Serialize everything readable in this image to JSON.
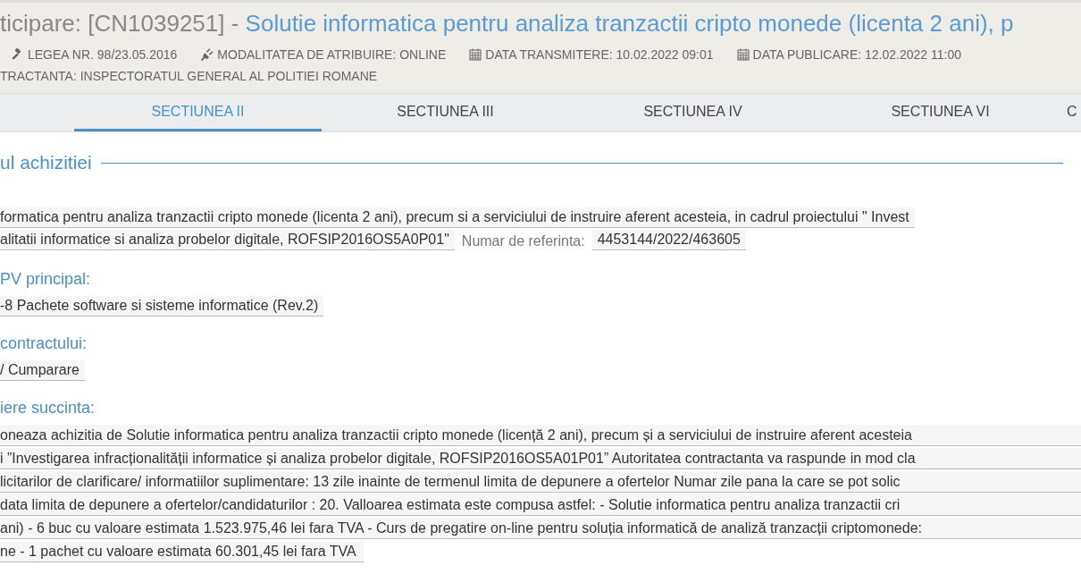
{
  "header": {
    "title_prefix": "ticipare: [CN1039251] - ",
    "title": "Solutie informatica pentru analiza tranzactii cripto monede (licenta 2 ani), p",
    "meta": [
      {
        "kind": "gavel",
        "text": "LEGEA NR. 98/23.05.2016"
      },
      {
        "kind": "plug",
        "text": "MODALITATEA DE ATRIBUIRE: ONLINE"
      },
      {
        "kind": "calendar",
        "text": "DATA TRANSMITERE: 10.02.2022 09:01"
      },
      {
        "kind": "calendar",
        "text": "DATA PUBLICARE: 12.02.2022 11:00"
      }
    ],
    "authority": "TRACTANTA: INSPECTORATUL GENERAL AL POLITIEI ROMANE"
  },
  "tabs": [
    {
      "label": "SECTIUNEA II",
      "selected": true
    },
    {
      "label": "SECTIUNEA III",
      "selected": false
    },
    {
      "label": "SECTIUNEA IV",
      "selected": false
    },
    {
      "label": "SECTIUNEA VI",
      "selected": false
    },
    {
      "label": "C",
      "selected": false
    }
  ],
  "section": {
    "legend": "ul achizitiei",
    "title_lines": [
      "formatica pentru analiza tranzactii cripto monede (licenta 2 ani), precum si a serviciului de instruire aferent acesteia, in cadrul proiectului \" Invest",
      "alitatii informatice si analiza probelor digitale, ROFSIP2016OS5A0P01\""
    ],
    "reference_label": "Numar de referinta:",
    "reference_value": "4453144/2022/463605",
    "cpv_label": "PV principal:",
    "cpv_value": "-8 Pachete software si sisteme informatice (Rev.2)",
    "type_label": "contractului:",
    "type_value": "/ Cumparare",
    "description_label": "iere succinta:",
    "description_lines": [
      "oneaza achizitia de Solutie informatica pentru analiza tranzactii cripto monede (licență 2 ani), precum și a serviciului de instruire aferent acesteia",
      "i ”Investigarea infracționalității informatice și analiza probelor digitale, ROFSIP2016OS5A01P01” Autoritatea contractanta va raspunde in mod cla",
      "licitarilor de clarificare/ informatiilor suplimentare: 13 zile inainte de termenul limita de depunere a ofertelor Numar zile pana la care se pot solic",
      "data limita de depunere a ofertelor/candidaturilor : 20. Valloarea estimata este compusa astfel: - Solutie informatica pentru analiza tranzactii cri",
      "ani) - 6 buc cu valoare estimata 1.523.975,46 lei fara TVA - Curs de pregatire on-line pentru soluția informatică de analiză tranzacții criptomonede:",
      "ne - 1 pachet cu valoare estimata 60.301,45 lei fara TVA"
    ]
  }
}
